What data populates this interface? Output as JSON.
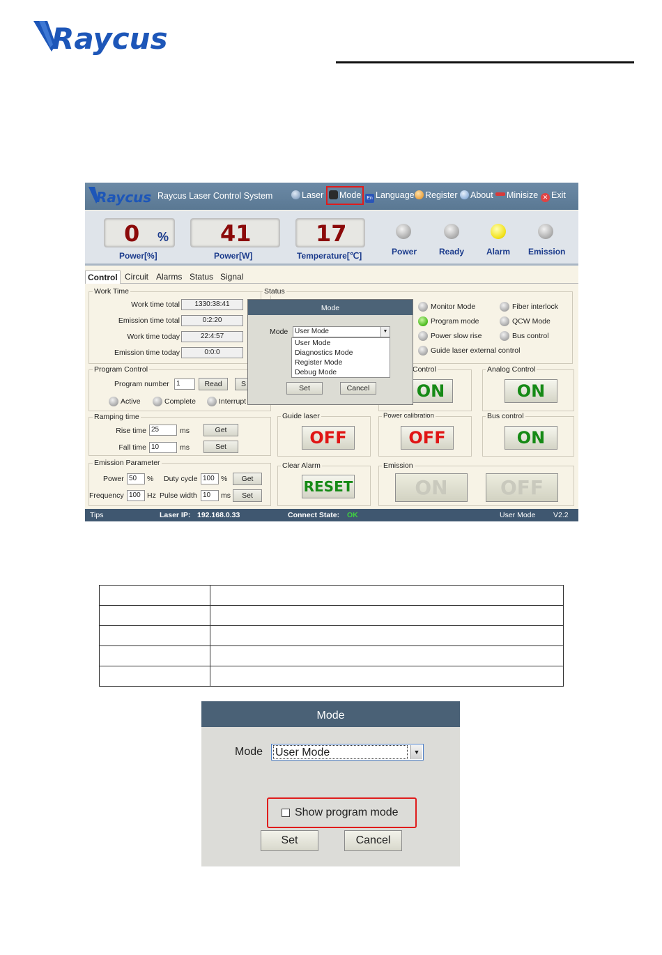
{
  "header": {
    "logo_text": "Raycus",
    "colors": {
      "brand": "#1d56b8",
      "rule": "#111111"
    }
  },
  "app": {
    "title": "Raycus Laser Control System",
    "menu": [
      {
        "label": "Laser",
        "icon": "laser-icon"
      },
      {
        "label": "Mode",
        "icon": "mode-icon"
      },
      {
        "label": "Language",
        "icon": "language-icon",
        "badge": "En"
      },
      {
        "label": "Register",
        "icon": "register-icon"
      },
      {
        "label": "About",
        "icon": "about-icon"
      },
      {
        "label": "Minisize",
        "icon": "minimize-icon"
      },
      {
        "label": "Exit",
        "icon": "exit-icon"
      }
    ],
    "readouts": [
      {
        "value": "0",
        "unit": "%",
        "label": "Power[%]"
      },
      {
        "value": "41",
        "label": "Power[W]"
      },
      {
        "value": "17",
        "label": "Temperature[℃]"
      }
    ],
    "indicators": [
      {
        "label": "Power",
        "state": "off"
      },
      {
        "label": "Ready",
        "state": "off"
      },
      {
        "label": "Alarm",
        "state": "yellow"
      },
      {
        "label": "Emission",
        "state": "off"
      }
    ],
    "tabs": [
      "Control",
      "Circuit",
      "Alarms",
      "Status",
      "Signal"
    ],
    "active_tab": "Control",
    "work_time": {
      "title": "Work Time",
      "rows": [
        {
          "label": "Work time total",
          "value": "1330:38:41"
        },
        {
          "label": "Emission time total",
          "value": "0:2:20"
        },
        {
          "label": "Work time today",
          "value": "22:4:57"
        },
        {
          "label": "Emission time today",
          "value": "0:0:0"
        }
      ]
    },
    "program_control": {
      "title": "Program Control",
      "number_label": "Program number",
      "number_value": "1",
      "read_label": "Read",
      "set_partial": "S",
      "states": [
        "Active",
        "Complete",
        "Interrupt"
      ]
    },
    "ramping": {
      "title": "Ramping time",
      "rise_label": "Rise time",
      "rise_value": "25",
      "fall_label": "Fall time",
      "fall_value": "10",
      "unit": "ms",
      "get_label": "Get",
      "set_label": "Set"
    },
    "emission_param": {
      "title": "Emission Parameter",
      "power_label": "Power",
      "power_value": "50",
      "power_unit": "%",
      "duty_label": "Duty cycle",
      "duty_value": "100",
      "duty_unit": "%",
      "freq_label": "Frequency",
      "freq_value": "100",
      "freq_unit": "Hz",
      "pulse_label": "Pulse width",
      "pulse_value": "10",
      "pulse_unit": "ms",
      "get_label": "Get",
      "set_label": "Set"
    },
    "status": {
      "title": "Status",
      "items": [
        {
          "label": "Monitor Mode",
          "state": "off"
        },
        {
          "label": "Fiber interlock",
          "state": "off"
        },
        {
          "label": "Program mode",
          "state": "green"
        },
        {
          "label": "QCW Mode",
          "state": "off"
        },
        {
          "label": "Power slow rise",
          "state": "off"
        },
        {
          "label": "Bus control",
          "state": "off"
        },
        {
          "label": "Guide laser external control",
          "state": "off"
        }
      ]
    },
    "controls": {
      "control_partial_title": "Control",
      "control_partial_value": "ON",
      "analog_title": "Analog Control",
      "analog_value": "ON",
      "guide_title": "Guide laser",
      "guide_value": "OFF",
      "calib_title": "Power calibration",
      "calib_value": "OFF",
      "bus_title": "Bus control",
      "bus_value": "ON",
      "clear_title": "Clear Alarm",
      "clear_value": "RESET",
      "emission_title": "Emission",
      "emission_on": "ON",
      "emission_off": "OFF"
    },
    "mode_dialog": {
      "title": "Mode",
      "mode_label": "Mode",
      "selected": "User Mode",
      "options": [
        "User Mode",
        "Diagnostics Mode",
        "Register Mode",
        "Debug Mode"
      ],
      "set_label": "Set",
      "cancel_label": "Cancel"
    },
    "statusbar": {
      "tips": "Tips",
      "ip_label": "Laser IP:",
      "ip_value": "192.168.0.33",
      "connect_label": "Connect State:",
      "connect_value": "OK",
      "mode": "User Mode",
      "version": "V2.2"
    }
  },
  "big_dialog": {
    "title": "Mode",
    "mode_label": "Mode",
    "selected": "User Mode",
    "checkbox_label": "Show program mode",
    "checkbox_checked": false,
    "set_label": "Set",
    "cancel_label": "Cancel"
  }
}
